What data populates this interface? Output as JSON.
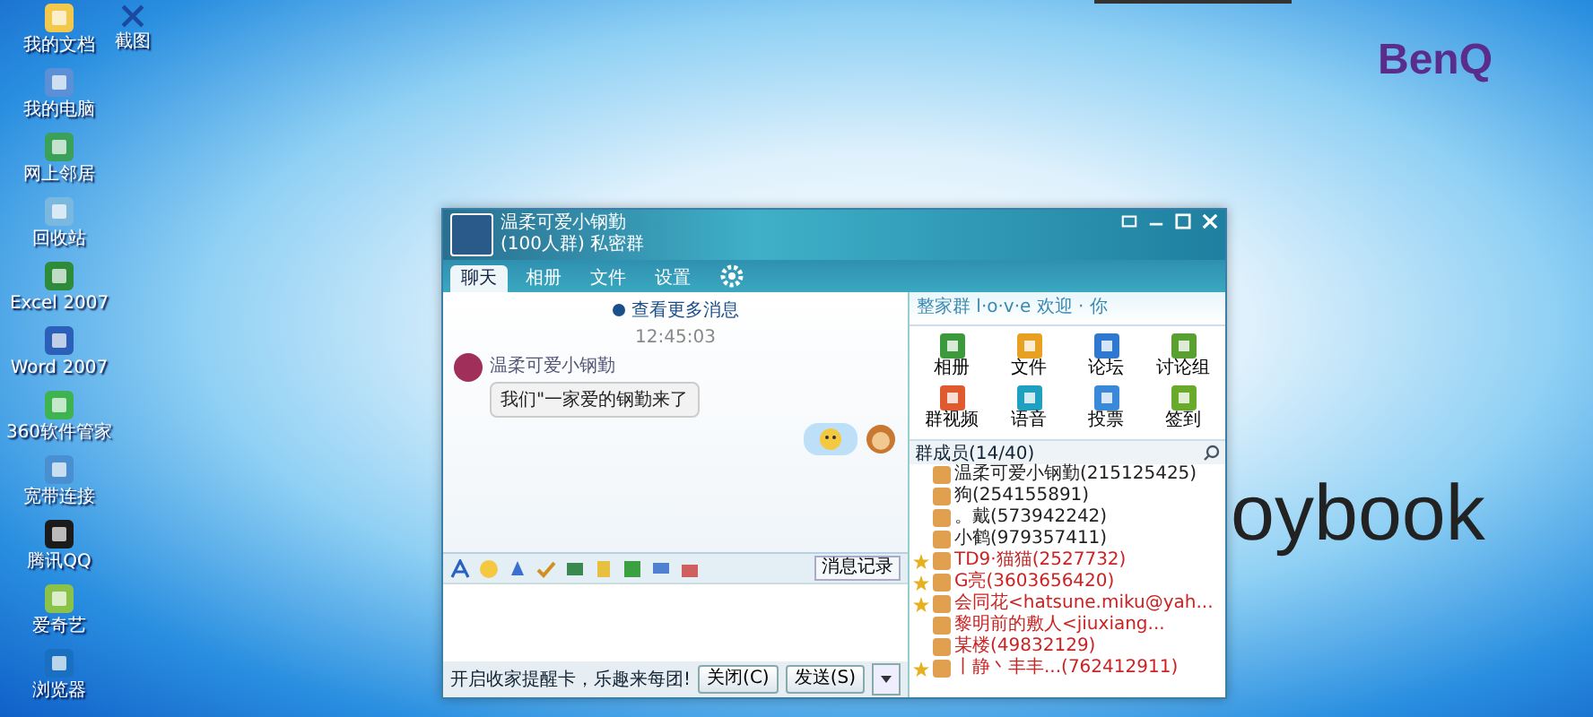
{
  "desktop": {
    "icons": [
      {
        "label": "我的文档"
      },
      {
        "label": "我的电脑"
      },
      {
        "label": "网上邻居"
      },
      {
        "label": "回收站"
      },
      {
        "label": "Excel 2007"
      },
      {
        "label": "Word 2007"
      },
      {
        "label": "360软件管家"
      },
      {
        "label": "宽带连接"
      },
      {
        "label": "腾讯QQ"
      },
      {
        "label": "爱奇艺"
      },
      {
        "label": "浏览器"
      }
    ],
    "top_icon": {
      "label": "截图"
    },
    "brand": "BenQ",
    "wallpaper_text": "oybook"
  },
  "window": {
    "group_name": "温柔可爱小钢勤",
    "subtitle": "(100人群) 私密群",
    "tabs": [
      {
        "label": "聊天",
        "selected": true
      },
      {
        "label": "相册",
        "selected": false
      },
      {
        "label": "文件",
        "selected": false
      },
      {
        "label": "设置",
        "selected": false
      }
    ],
    "more_messages": "查看更多消息",
    "messages": [
      {
        "kind": "time",
        "text": "12:45:03"
      },
      {
        "kind": "incoming",
        "sender": "温柔可爱小钢勤",
        "text": "我们\"一家爱的钢勤来了"
      },
      {
        "kind": "outgoing-emoji"
      }
    ],
    "history_button": "消息记录",
    "tip": "开启收家提醒卡，乐趣来每团!",
    "buttons": [
      {
        "label": "关闭(C)"
      },
      {
        "label": "发送(S)"
      }
    ],
    "banner": "整家群 l·o·v·e 欢迎 · 你",
    "apps": [
      {
        "label": "相册"
      },
      {
        "label": "文件"
      },
      {
        "label": "论坛"
      },
      {
        "label": "讨论组"
      },
      {
        "label": "群视频"
      },
      {
        "label": "语音"
      },
      {
        "label": "投票"
      },
      {
        "label": "签到"
      }
    ],
    "members_title": "群成员(14/40)",
    "members": [
      {
        "name": "温柔可爱小钢勤(215125425)",
        "color": "#222222",
        "starred": false
      },
      {
        "name": "狗(254155891)",
        "color": "#222222",
        "starred": false
      },
      {
        "name": "。戴(573942242)",
        "color": "#222222",
        "starred": false
      },
      {
        "name": "小鹤(979357411)",
        "color": "#222222",
        "starred": false
      },
      {
        "name": "TD9·猫猫(2527732)",
        "color": "#cc2222",
        "starred": true
      },
      {
        "name": "G亮(3603656420)",
        "color": "#cc2222",
        "starred": true
      },
      {
        "name": "会同花<hatsune.miku@yah...",
        "color": "#cc2222",
        "starred": true
      },
      {
        "name": "黎明前的敷人<jiuxiang...",
        "color": "#cc2222",
        "starred": false
      },
      {
        "name": "某楼(49832129)",
        "color": "#cc2222",
        "starred": false
      },
      {
        "name": "丨静丶丰丰...(762412911)",
        "color": "#cc2222",
        "starred": true
      }
    ]
  }
}
